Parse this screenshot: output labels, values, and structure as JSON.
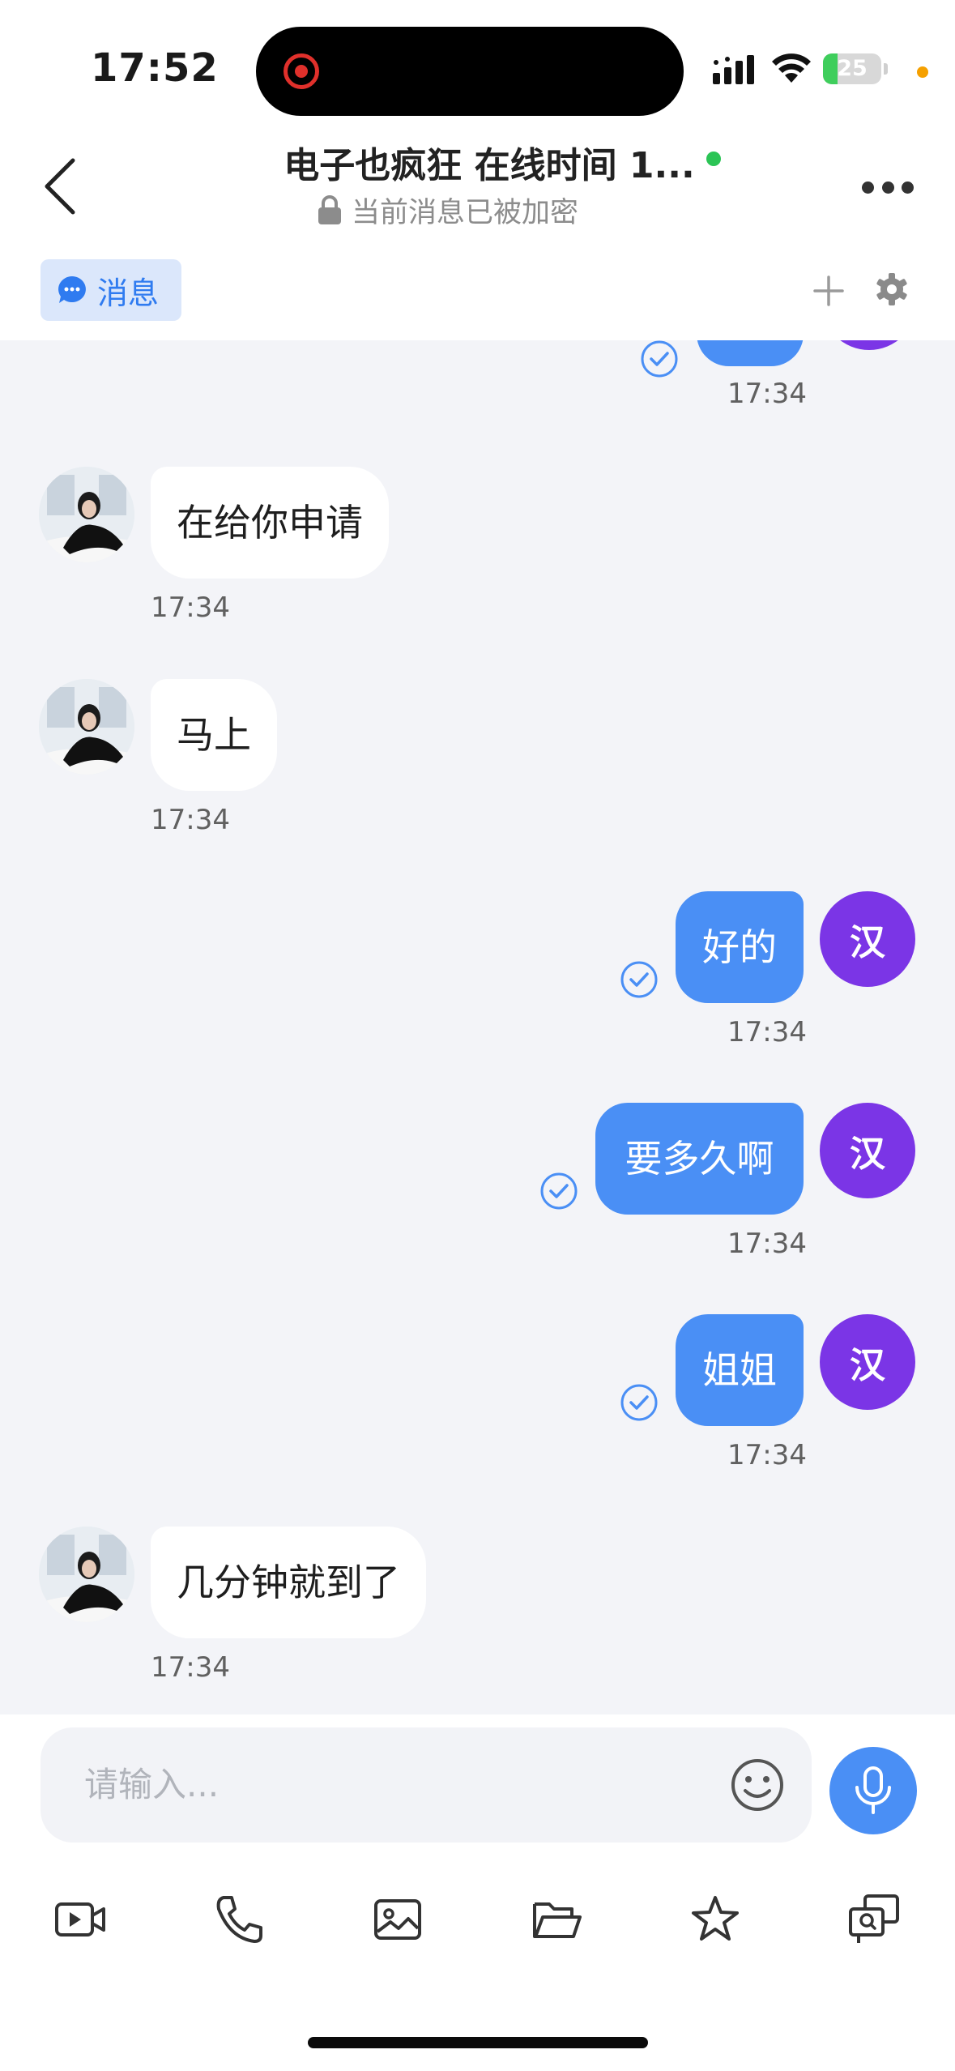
{
  "status_bar": {
    "time": "17:52",
    "battery": "25",
    "battery_level": 0.25
  },
  "header": {
    "title": "电子也疯狂  在线时间 1...",
    "subtitle": "当前消息已被加密"
  },
  "tabs": {
    "active_label": "消息"
  },
  "messages": [
    {
      "side": "right",
      "text": "",
      "time": "17:34",
      "partial": true
    },
    {
      "side": "left",
      "text": "在给你申请",
      "time": "17:34"
    },
    {
      "side": "left",
      "text": "马上",
      "time": "17:34"
    },
    {
      "side": "right",
      "text": "好的",
      "time": "17:34",
      "avatar": "汉"
    },
    {
      "side": "right",
      "text": "要多久啊",
      "time": "17:34",
      "avatar": "汉"
    },
    {
      "side": "right",
      "text": "姐姐",
      "time": "17:34",
      "avatar": "汉"
    },
    {
      "side": "left",
      "text": "几分钟就到了",
      "time": "17:34"
    }
  ],
  "composer": {
    "placeholder": "请输入..."
  },
  "toolbar": [
    "video-icon",
    "phone-icon",
    "image-icon",
    "folder-icon",
    "star-icon",
    "screen-share-icon"
  ],
  "colors": {
    "accent": "#4a8ff5",
    "avatar_purple": "#7b35e6",
    "online": "#2bc455",
    "chat_bg": "#f3f4f8"
  }
}
